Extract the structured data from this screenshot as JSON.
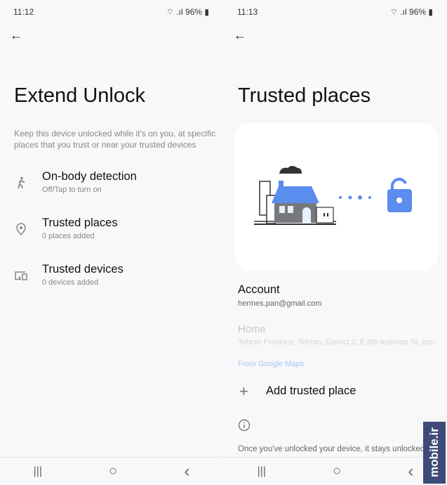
{
  "left": {
    "status": {
      "time": "11:12",
      "battery": "96%"
    },
    "title": "Extend Unlock",
    "description": "Keep this device unlocked while it's on you, at specific places that you trust or near your trusted devices",
    "items": [
      {
        "icon": "walking-person-icon",
        "title": "On-body detection",
        "subtitle": "Off/Tap to turn on"
      },
      {
        "icon": "location-pin-icon",
        "title": "Trusted places",
        "subtitle": "0 places added"
      },
      {
        "icon": "devices-icon",
        "title": "Trusted devices",
        "subtitle": "0 devices added"
      }
    ]
  },
  "right": {
    "status": {
      "time": "11:13",
      "battery": "96%"
    },
    "title": "Trusted places",
    "account_label": "Account",
    "account_email": "hermes.pan@gmail.com",
    "place_name": "Home",
    "place_address": "Tehran Province, Tehran, District 2, E 6th Aseman St, Iran",
    "place_source": "From Google Maps",
    "add_label": "Add trusted place",
    "info_text": "Once you've unlocked your device, it stays unlocked"
  },
  "nav": {
    "recents": "|||",
    "home": "○",
    "back": "‹"
  },
  "watermark": "mobile.ir",
  "colors": {
    "accent": "#5b8def",
    "link": "#a8c4f0"
  }
}
